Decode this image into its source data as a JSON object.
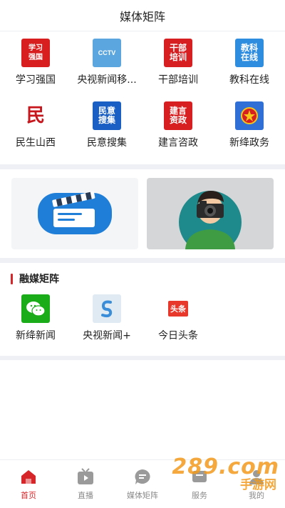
{
  "header": {
    "title": "媒体矩阵"
  },
  "matrix": {
    "items": [
      {
        "label": "学习强国",
        "icon": "xuexi-qiangguo-logo-icon",
        "color": "#d81e1e",
        "glyph": "学习\n强国"
      },
      {
        "label": "央视新闻移...",
        "icon": "cctv-news-logo-icon",
        "color": "#5ba6de",
        "glyph": "CCTV"
      },
      {
        "label": "干部培训",
        "icon": "cadre-training-logo-icon",
        "color": "#d71f22",
        "glyph": "干部\n培训"
      },
      {
        "label": "教科在线",
        "icon": "education-online-logo-icon",
        "color": "#2f8de0",
        "glyph": "教科\n在线"
      },
      {
        "label": "民生山西",
        "icon": "minsheng-shanxi-logo-icon",
        "color": "#ffffff",
        "glyph": "民"
      },
      {
        "label": "民意搜集",
        "icon": "public-opinion-logo-icon",
        "color": "#1a5fc4",
        "glyph": "民意\n搜集"
      },
      {
        "label": "建言咨政",
        "icon": "advice-logo-icon",
        "color": "#d71f22",
        "glyph": "建言\n资政"
      },
      {
        "label": "新绛政务",
        "icon": "government-emblem-icon",
        "color": "#2f6fd6",
        "glyph": "☆"
      }
    ]
  },
  "banners": [
    {
      "name": "video-clapper-banner",
      "icon": "clapperboard-icon"
    },
    {
      "name": "photographer-banner",
      "icon": "camera-icon"
    }
  ],
  "fusion": {
    "title": "融媒矩阵",
    "items": [
      {
        "label": "新绛新闻",
        "icon": "wechat-logo-icon",
        "color": "#1aad19"
      },
      {
        "label": "央视新闻+",
        "icon": "cctv-plus-logo-icon",
        "color": "#3a8dd8"
      },
      {
        "label": "今日头条",
        "icon": "toutiao-logo-icon",
        "color": "#e8372b",
        "glyph": "头条"
      }
    ]
  },
  "tabbar": {
    "items": [
      {
        "label": "首页",
        "icon": "home-icon",
        "active": true
      },
      {
        "label": "直播",
        "icon": "tv-play-icon",
        "active": false
      },
      {
        "label": "媒体矩阵",
        "icon": "chat-bubble-icon",
        "active": false
      },
      {
        "label": "服务",
        "icon": "service-icon",
        "active": false
      },
      {
        "label": "我的",
        "icon": "profile-icon",
        "active": false
      }
    ]
  },
  "watermark": {
    "text": "289.com",
    "sub": "手游网"
  },
  "colors": {
    "accent": "#d6262a",
    "separator": "#eef0f5",
    "inactive": "#8a8a8a"
  }
}
